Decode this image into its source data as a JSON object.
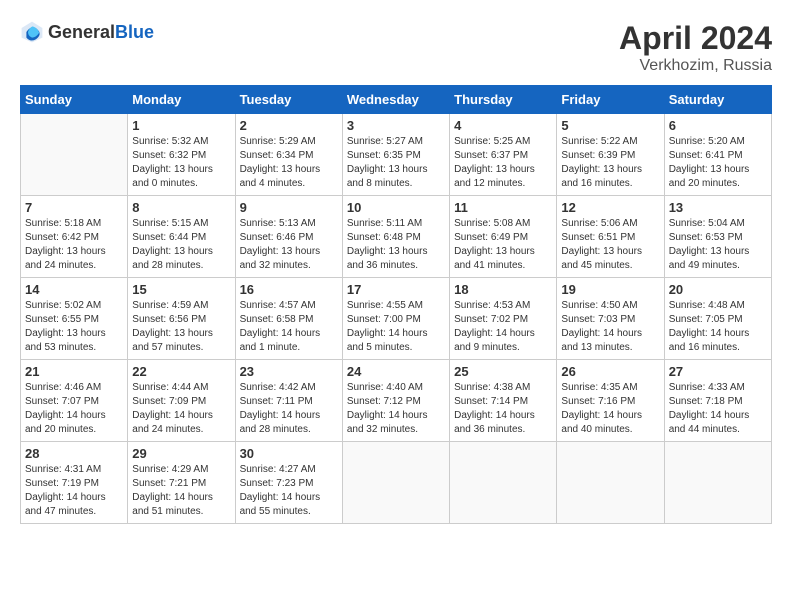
{
  "header": {
    "logo_general": "General",
    "logo_blue": "Blue",
    "month_year": "April 2024",
    "location": "Verkhozim, Russia"
  },
  "days_of_week": [
    "Sunday",
    "Monday",
    "Tuesday",
    "Wednesday",
    "Thursday",
    "Friday",
    "Saturday"
  ],
  "weeks": [
    [
      {
        "day": "",
        "sunrise": "",
        "sunset": "",
        "daylight": ""
      },
      {
        "day": "1",
        "sunrise": "Sunrise: 5:32 AM",
        "sunset": "Sunset: 6:32 PM",
        "daylight": "Daylight: 13 hours and 0 minutes."
      },
      {
        "day": "2",
        "sunrise": "Sunrise: 5:29 AM",
        "sunset": "Sunset: 6:34 PM",
        "daylight": "Daylight: 13 hours and 4 minutes."
      },
      {
        "day": "3",
        "sunrise": "Sunrise: 5:27 AM",
        "sunset": "Sunset: 6:35 PM",
        "daylight": "Daylight: 13 hours and 8 minutes."
      },
      {
        "day": "4",
        "sunrise": "Sunrise: 5:25 AM",
        "sunset": "Sunset: 6:37 PM",
        "daylight": "Daylight: 13 hours and 12 minutes."
      },
      {
        "day": "5",
        "sunrise": "Sunrise: 5:22 AM",
        "sunset": "Sunset: 6:39 PM",
        "daylight": "Daylight: 13 hours and 16 minutes."
      },
      {
        "day": "6",
        "sunrise": "Sunrise: 5:20 AM",
        "sunset": "Sunset: 6:41 PM",
        "daylight": "Daylight: 13 hours and 20 minutes."
      }
    ],
    [
      {
        "day": "7",
        "sunrise": "Sunrise: 5:18 AM",
        "sunset": "Sunset: 6:42 PM",
        "daylight": "Daylight: 13 hours and 24 minutes."
      },
      {
        "day": "8",
        "sunrise": "Sunrise: 5:15 AM",
        "sunset": "Sunset: 6:44 PM",
        "daylight": "Daylight: 13 hours and 28 minutes."
      },
      {
        "day": "9",
        "sunrise": "Sunrise: 5:13 AM",
        "sunset": "Sunset: 6:46 PM",
        "daylight": "Daylight: 13 hours and 32 minutes."
      },
      {
        "day": "10",
        "sunrise": "Sunrise: 5:11 AM",
        "sunset": "Sunset: 6:48 PM",
        "daylight": "Daylight: 13 hours and 36 minutes."
      },
      {
        "day": "11",
        "sunrise": "Sunrise: 5:08 AM",
        "sunset": "Sunset: 6:49 PM",
        "daylight": "Daylight: 13 hours and 41 minutes."
      },
      {
        "day": "12",
        "sunrise": "Sunrise: 5:06 AM",
        "sunset": "Sunset: 6:51 PM",
        "daylight": "Daylight: 13 hours and 45 minutes."
      },
      {
        "day": "13",
        "sunrise": "Sunrise: 5:04 AM",
        "sunset": "Sunset: 6:53 PM",
        "daylight": "Daylight: 13 hours and 49 minutes."
      }
    ],
    [
      {
        "day": "14",
        "sunrise": "Sunrise: 5:02 AM",
        "sunset": "Sunset: 6:55 PM",
        "daylight": "Daylight: 13 hours and 53 minutes."
      },
      {
        "day": "15",
        "sunrise": "Sunrise: 4:59 AM",
        "sunset": "Sunset: 6:56 PM",
        "daylight": "Daylight: 13 hours and 57 minutes."
      },
      {
        "day": "16",
        "sunrise": "Sunrise: 4:57 AM",
        "sunset": "Sunset: 6:58 PM",
        "daylight": "Daylight: 14 hours and 1 minute."
      },
      {
        "day": "17",
        "sunrise": "Sunrise: 4:55 AM",
        "sunset": "Sunset: 7:00 PM",
        "daylight": "Daylight: 14 hours and 5 minutes."
      },
      {
        "day": "18",
        "sunrise": "Sunrise: 4:53 AM",
        "sunset": "Sunset: 7:02 PM",
        "daylight": "Daylight: 14 hours and 9 minutes."
      },
      {
        "day": "19",
        "sunrise": "Sunrise: 4:50 AM",
        "sunset": "Sunset: 7:03 PM",
        "daylight": "Daylight: 14 hours and 13 minutes."
      },
      {
        "day": "20",
        "sunrise": "Sunrise: 4:48 AM",
        "sunset": "Sunset: 7:05 PM",
        "daylight": "Daylight: 14 hours and 16 minutes."
      }
    ],
    [
      {
        "day": "21",
        "sunrise": "Sunrise: 4:46 AM",
        "sunset": "Sunset: 7:07 PM",
        "daylight": "Daylight: 14 hours and 20 minutes."
      },
      {
        "day": "22",
        "sunrise": "Sunrise: 4:44 AM",
        "sunset": "Sunset: 7:09 PM",
        "daylight": "Daylight: 14 hours and 24 minutes."
      },
      {
        "day": "23",
        "sunrise": "Sunrise: 4:42 AM",
        "sunset": "Sunset: 7:11 PM",
        "daylight": "Daylight: 14 hours and 28 minutes."
      },
      {
        "day": "24",
        "sunrise": "Sunrise: 4:40 AM",
        "sunset": "Sunset: 7:12 PM",
        "daylight": "Daylight: 14 hours and 32 minutes."
      },
      {
        "day": "25",
        "sunrise": "Sunrise: 4:38 AM",
        "sunset": "Sunset: 7:14 PM",
        "daylight": "Daylight: 14 hours and 36 minutes."
      },
      {
        "day": "26",
        "sunrise": "Sunrise: 4:35 AM",
        "sunset": "Sunset: 7:16 PM",
        "daylight": "Daylight: 14 hours and 40 minutes."
      },
      {
        "day": "27",
        "sunrise": "Sunrise: 4:33 AM",
        "sunset": "Sunset: 7:18 PM",
        "daylight": "Daylight: 14 hours and 44 minutes."
      }
    ],
    [
      {
        "day": "28",
        "sunrise": "Sunrise: 4:31 AM",
        "sunset": "Sunset: 7:19 PM",
        "daylight": "Daylight: 14 hours and 47 minutes."
      },
      {
        "day": "29",
        "sunrise": "Sunrise: 4:29 AM",
        "sunset": "Sunset: 7:21 PM",
        "daylight": "Daylight: 14 hours and 51 minutes."
      },
      {
        "day": "30",
        "sunrise": "Sunrise: 4:27 AM",
        "sunset": "Sunset: 7:23 PM",
        "daylight": "Daylight: 14 hours and 55 minutes."
      },
      {
        "day": "",
        "sunrise": "",
        "sunset": "",
        "daylight": ""
      },
      {
        "day": "",
        "sunrise": "",
        "sunset": "",
        "daylight": ""
      },
      {
        "day": "",
        "sunrise": "",
        "sunset": "",
        "daylight": ""
      },
      {
        "day": "",
        "sunrise": "",
        "sunset": "",
        "daylight": ""
      }
    ]
  ]
}
